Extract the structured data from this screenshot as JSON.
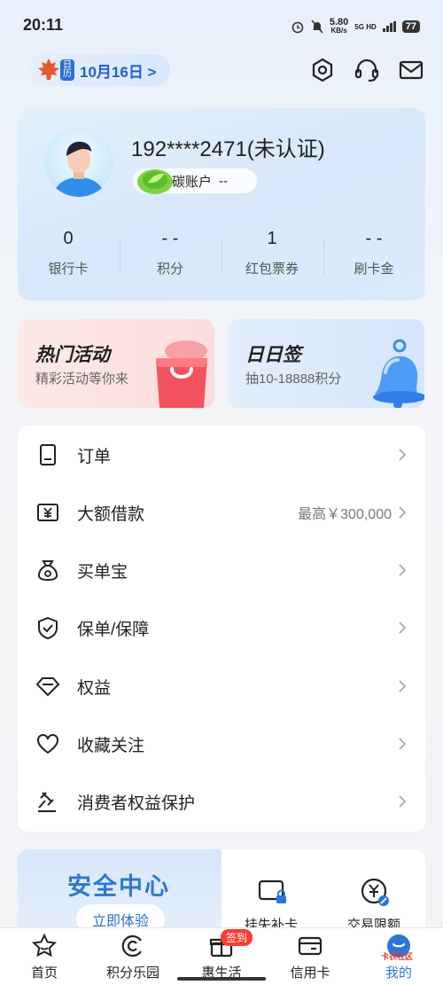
{
  "status_bar": {
    "time": "20:11",
    "speed": "5.80",
    "speed_unit": "KB/s",
    "network": "5G HD",
    "battery": "77"
  },
  "header": {
    "calendar_badge": "日历",
    "date": "10月16日 >"
  },
  "profile": {
    "phone": "192****2471(未认证)",
    "carbon_label": "碳账户",
    "carbon_value": "--",
    "stats": [
      {
        "value": "0",
        "label": "银行卡"
      },
      {
        "value": "- -",
        "label": "积分"
      },
      {
        "value": "1",
        "label": "红包票券"
      },
      {
        "value": "- -",
        "label": "刷卡金"
      }
    ]
  },
  "promos": {
    "hot": {
      "title": "热门活动",
      "subtitle": "精彩活动等你来"
    },
    "daily": {
      "title": "日日签",
      "subtitle": "抽10-18888积分"
    }
  },
  "menu": [
    {
      "label": "订单",
      "icon": "document-icon",
      "extra": ""
    },
    {
      "label": "大额借款",
      "icon": "yuan-icon",
      "extra": "最高￥300,000"
    },
    {
      "label": "买单宝",
      "icon": "money-bag-icon",
      "extra": ""
    },
    {
      "label": "保单/保障",
      "icon": "shield-icon",
      "extra": ""
    },
    {
      "label": "权益",
      "icon": "diamond-icon",
      "extra": ""
    },
    {
      "label": "收藏关注",
      "icon": "heart-icon",
      "extra": ""
    },
    {
      "label": "消费者权益保护",
      "icon": "gavel-icon",
      "extra": ""
    }
  ],
  "security": {
    "title": "安全中心",
    "button": "立即体验",
    "item1": "挂失补卡",
    "item2": "交易限额"
  },
  "bottom_nav": [
    {
      "label": "首页",
      "icon": "star-icon"
    },
    {
      "label": "积分乐园",
      "icon": "points-icon"
    },
    {
      "label": "惠生活",
      "icon": "gift-icon",
      "badge": "签到"
    },
    {
      "label": "信用卡",
      "icon": "credit-card-icon"
    },
    {
      "label": "我的",
      "icon": "profile-icon",
      "active": true
    }
  ],
  "watermark": "卡农社区",
  "colors": {
    "accent": "#2c76d8",
    "badge": "#ff3b2f",
    "date": "#1d5fd6"
  }
}
